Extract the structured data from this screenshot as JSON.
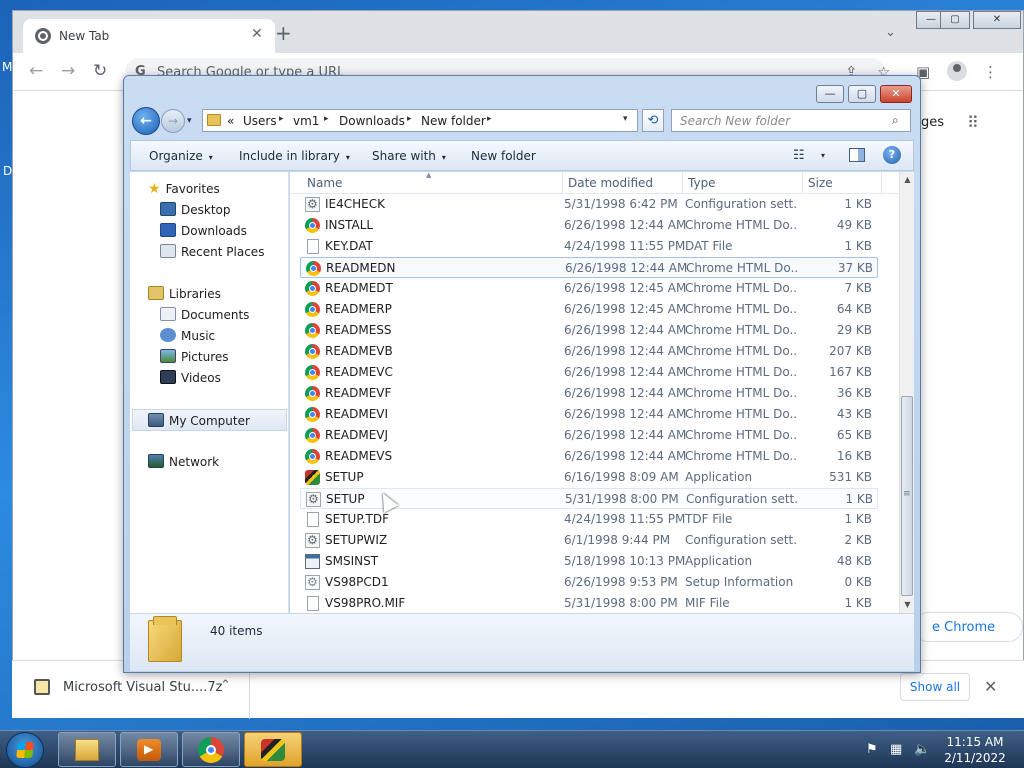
{
  "desktop": {
    "glyph_top": "M",
    "glyph_mid": "D"
  },
  "chrome": {
    "tab_title": "New Tab",
    "tab_close": "✕",
    "new_tab": "+",
    "tab_search": "⌄",
    "win_min": "—",
    "win_max": "▢",
    "win_close": "✕",
    "back": "←",
    "forward": "→",
    "reload": "↻",
    "omnibox_g": "G",
    "omnibox_placeholder": "Search Google or type a URL",
    "share": "⇪",
    "bookmark": "☆",
    "sidepanel": "▣",
    "menu": "⋮",
    "images_link": "ges",
    "apps": "⠿",
    "customize_label": "e Chrome"
  },
  "download_bar": {
    "filename": "Microsoft Visual Stu....7z",
    "chevron": "⌃",
    "show_all": "Show all",
    "close": "✕"
  },
  "explorer": {
    "win_min": "—",
    "win_max": "▢",
    "win_close": "✕",
    "back": "←",
    "forward": "→",
    "recent": "▾",
    "breadcrumb_lead": "«",
    "breadcrumbs": [
      "Users",
      "vm1",
      "Downloads",
      "New folder"
    ],
    "sep": "▸",
    "addr_drop": "▾",
    "refresh": "⟲",
    "search_placeholder": "Search New folder",
    "search_icon": "⌕",
    "commands": {
      "organize": "Organize",
      "include_in_library": "Include in library",
      "share_with": "Share with",
      "new_folder": "New folder",
      "arrow": "▾",
      "view_icon": "☷",
      "help": "?"
    },
    "nav": {
      "favorites": "Favorites",
      "desktop": "Desktop",
      "downloads": "Downloads",
      "recent_places": "Recent Places",
      "libraries": "Libraries",
      "documents": "Documents",
      "music": "Music",
      "pictures": "Pictures",
      "videos": "Videos",
      "my_computer": "My Computer",
      "network": "Network",
      "star": "★"
    },
    "columns": {
      "name": "Name",
      "date": "Date modified",
      "type": "Type",
      "size": "Size",
      "sort": "▲"
    },
    "files": [
      {
        "name": "IE4CHECK",
        "date": "5/31/1998 6:42 PM",
        "type": "Configuration sett...",
        "size": "1 KB",
        "icon": "config-file-icon"
      },
      {
        "name": "INSTALL",
        "date": "6/26/1998 12:44 AM",
        "type": "Chrome HTML Do...",
        "size": "49 KB",
        "icon": "chrome-html-icon"
      },
      {
        "name": "KEY.DAT",
        "date": "4/24/1998 11:55 PM",
        "type": "DAT File",
        "size": "1 KB",
        "icon": "file-icon"
      },
      {
        "name": "READMEDN",
        "date": "6/26/1998 12:44 AM",
        "type": "Chrome HTML Do...",
        "size": "37 KB",
        "icon": "chrome-html-icon"
      },
      {
        "name": "READMEDT",
        "date": "6/26/1998 12:45 AM",
        "type": "Chrome HTML Do...",
        "size": "7 KB",
        "icon": "chrome-html-icon"
      },
      {
        "name": "READMERP",
        "date": "6/26/1998 12:45 AM",
        "type": "Chrome HTML Do...",
        "size": "64 KB",
        "icon": "chrome-html-icon"
      },
      {
        "name": "READMESS",
        "date": "6/26/1998 12:44 AM",
        "type": "Chrome HTML Do...",
        "size": "29 KB",
        "icon": "chrome-html-icon"
      },
      {
        "name": "READMEVB",
        "date": "6/26/1998 12:44 AM",
        "type": "Chrome HTML Do...",
        "size": "207 KB",
        "icon": "chrome-html-icon"
      },
      {
        "name": "READMEVC",
        "date": "6/26/1998 12:44 AM",
        "type": "Chrome HTML Do...",
        "size": "167 KB",
        "icon": "chrome-html-icon"
      },
      {
        "name": "READMEVF",
        "date": "6/26/1998 12:44 AM",
        "type": "Chrome HTML Do...",
        "size": "36 KB",
        "icon": "chrome-html-icon"
      },
      {
        "name": "READMEVI",
        "date": "6/26/1998 12:44 AM",
        "type": "Chrome HTML Do...",
        "size": "43 KB",
        "icon": "chrome-html-icon"
      },
      {
        "name": "READMEVJ",
        "date": "6/26/1998 12:44 AM",
        "type": "Chrome HTML Do...",
        "size": "65 KB",
        "icon": "chrome-html-icon"
      },
      {
        "name": "READMEVS",
        "date": "6/26/1998 12:44 AM",
        "type": "Chrome HTML Do...",
        "size": "16 KB",
        "icon": "chrome-html-icon"
      },
      {
        "name": "SETUP",
        "date": "6/16/1998 8:09 AM",
        "type": "Application",
        "size": "531 KB",
        "icon": "application-icon"
      },
      {
        "name": "SETUP",
        "date": "5/31/1998 8:00 PM",
        "type": "Configuration sett...",
        "size": "1 KB",
        "icon": "config-file-icon"
      },
      {
        "name": "SETUP.TDF",
        "date": "4/24/1998 11:55 PM",
        "type": "TDF File",
        "size": "1 KB",
        "icon": "file-icon"
      },
      {
        "name": "SETUPWIZ",
        "date": "6/1/1998 9:44 PM",
        "type": "Configuration sett...",
        "size": "2 KB",
        "icon": "config-file-icon"
      },
      {
        "name": "SMSINST",
        "date": "5/18/1998 10:13 PM",
        "type": "Application",
        "size": "48 KB",
        "icon": "window-app-icon"
      },
      {
        "name": "VS98PCD1",
        "date": "6/26/1998 9:53 PM",
        "type": "Setup Information",
        "size": "0 KB",
        "icon": "setup-info-icon"
      },
      {
        "name": "VS98PRO.MIF",
        "date": "5/31/1998 8:00 PM",
        "type": "MIF File",
        "size": "1 KB",
        "icon": "file-icon"
      }
    ],
    "selected_index": 3,
    "hover_index": 14,
    "scroll_up": "▲",
    "scroll_down": "▼",
    "scroll_grip": "≡",
    "item_count": "40 items"
  },
  "taskbar": {
    "time": "11:15 AM",
    "date": "2/11/2022",
    "tray_flag": "⚑",
    "tray_network": "▦",
    "tray_volume": "🔈"
  }
}
